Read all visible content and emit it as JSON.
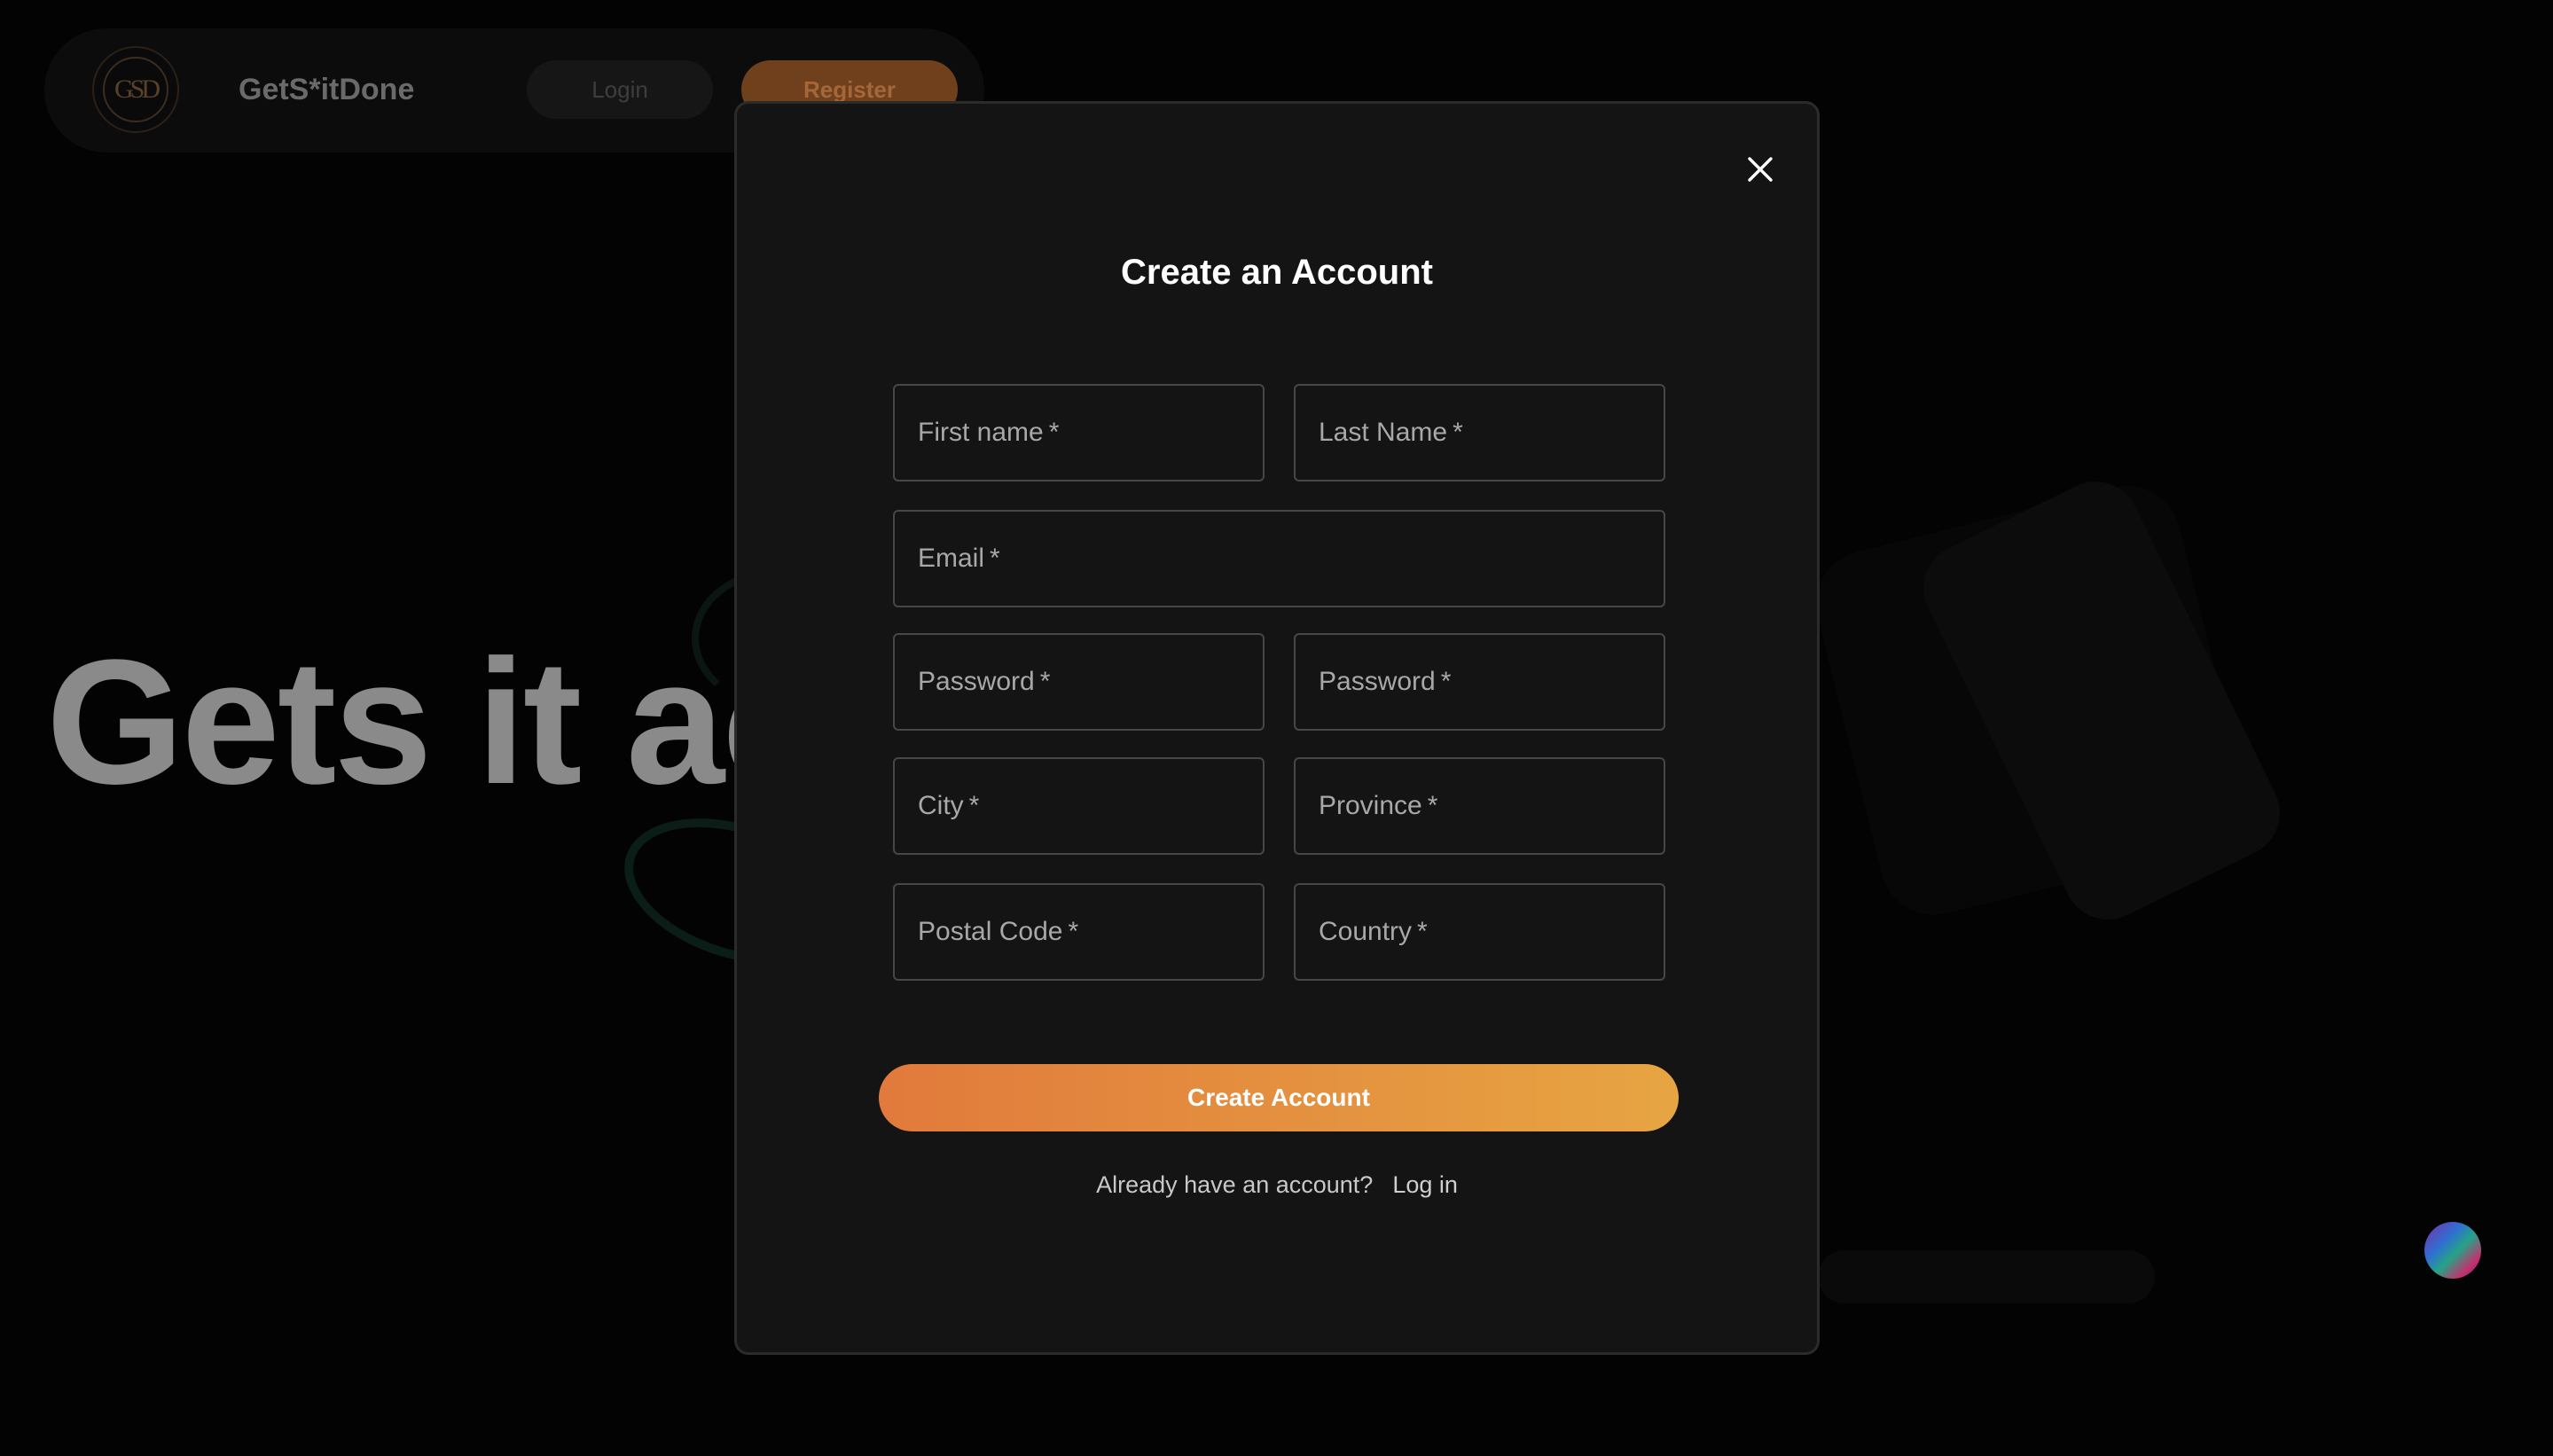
{
  "site": {
    "brand": "GetS*itDone",
    "logo_text": "GSD",
    "nav": {
      "login_label": "Login",
      "register_label": "Register"
    },
    "hero_text": "Gets it ac"
  },
  "modal": {
    "title": "Create an Account",
    "fields": {
      "first_name": "First name",
      "last_name": "Last Name",
      "email": "Email",
      "password": "Password",
      "password_confirm": "Password",
      "city": "City",
      "province": "Province",
      "postal_code": "Postal Code",
      "country": "Country"
    },
    "required_marker": "*",
    "submit_label": "Create Account",
    "signin_prompt": "Already have an account?",
    "signin_link": "Log in"
  },
  "colors": {
    "accent_gradient_start": "#e17a3c",
    "accent_gradient_end": "#e7a542",
    "modal_bg": "#141414",
    "field_border": "#474747"
  },
  "icons": {
    "close": "close-icon",
    "chat": "chat-orb-icon"
  }
}
